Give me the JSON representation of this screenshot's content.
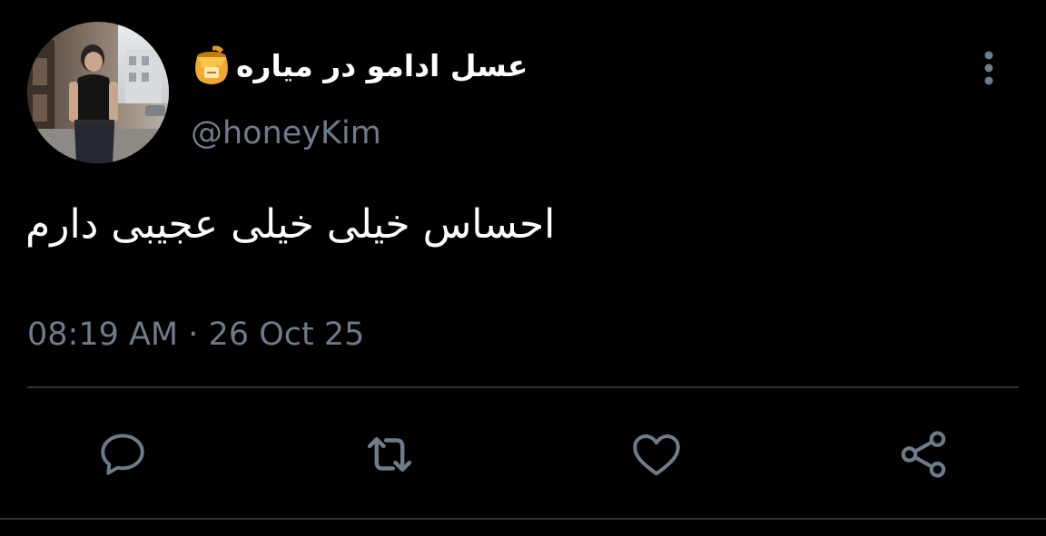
{
  "colors": {
    "background": "#000000",
    "primary_text": "#ffffff",
    "secondary_text": "#6e7b89",
    "icon": "#6e7b89",
    "divider": "#2f3336"
  },
  "author": {
    "display_name": "عسل ادامو در میاره",
    "name_emoji": "honey-pot-emoji",
    "handle": "@honeyKim",
    "avatar": "profile-photo"
  },
  "tweet": {
    "text": "احساس خیلی خیلی عجیبی دارم",
    "time": "08:19 AM",
    "separator": "·",
    "date": "26 Oct 25"
  },
  "actions": [
    {
      "name": "reply",
      "icon": "speech-bubble-icon"
    },
    {
      "name": "retweet",
      "icon": "retweet-arrows-icon"
    },
    {
      "name": "like",
      "icon": "heart-icon"
    },
    {
      "name": "share",
      "icon": "share-nodes-icon"
    }
  ],
  "menu_icon": "vertical-ellipsis-icon"
}
